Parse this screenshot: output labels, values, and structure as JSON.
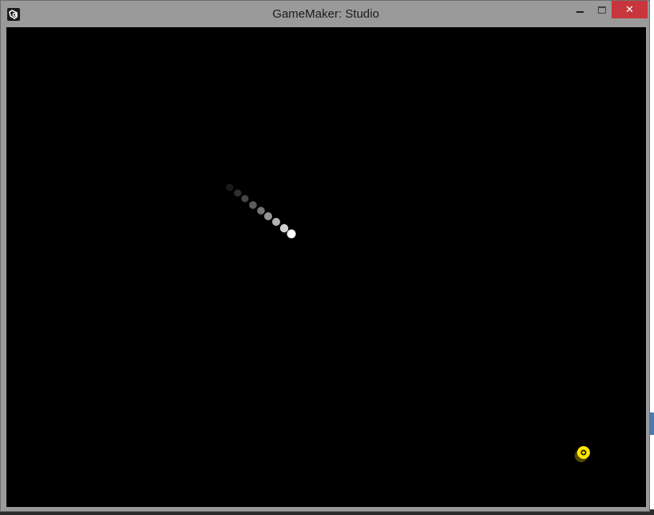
{
  "window": {
    "title": "GameMaker: Studio",
    "icon": "gamemaker-icon",
    "controls": {
      "minimize": "minimize-icon",
      "maximize": "maximize-icon",
      "close": "close-icon",
      "close_glyph": "✕"
    }
  },
  "game": {
    "background_color": "#000000",
    "ball_color": "#ffffff",
    "player_color": "#ffe600"
  }
}
